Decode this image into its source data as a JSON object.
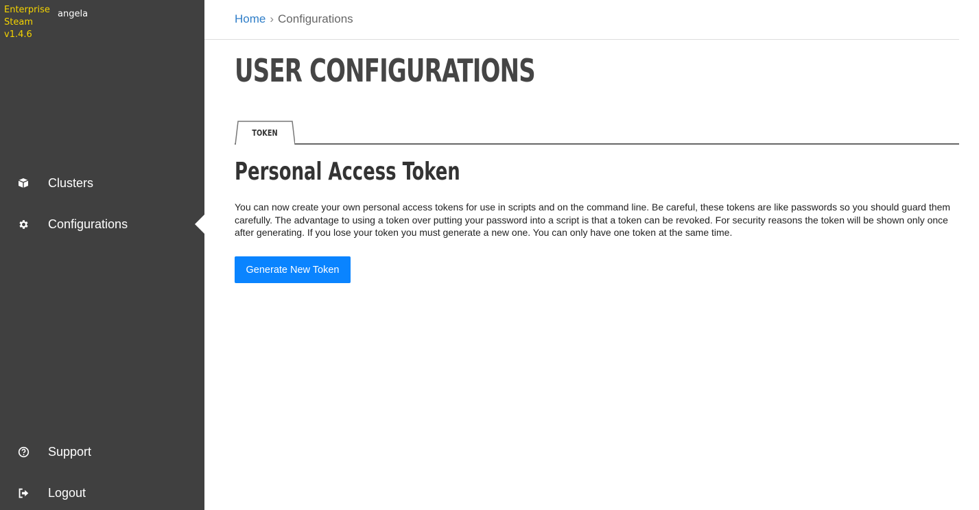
{
  "brand": {
    "line1": "Enterprise",
    "line2": "Steam",
    "version": "v1.4.6",
    "color": "#f5d400"
  },
  "user": {
    "name": "angela"
  },
  "sidebar": {
    "items": [
      {
        "label": "Clusters",
        "icon": "cube-icon"
      },
      {
        "label": "Configurations",
        "icon": "gear-icon",
        "active": true
      },
      {
        "label": "Support",
        "icon": "question-circle-icon"
      },
      {
        "label": "Logout",
        "icon": "sign-out-icon"
      }
    ],
    "background": "#404040"
  },
  "breadcrumb": {
    "home": "Home",
    "separator": "›",
    "current": "Configurations"
  },
  "page": {
    "title": "USER CONFIGURATIONS"
  },
  "tabs": [
    {
      "label": "TOKEN",
      "active": true
    }
  ],
  "token_section": {
    "title": "Personal Access Token",
    "description": "You can now create your own personal access tokens for use in scripts and on the command line. Be careful, these tokens are like passwords so you should guard them carefully. The advantage to using a token over putting your password into a script is that a token can be revoked. For security reasons the token will be shown only once after generating. If you lose your token you must generate a new one. You can only have one token at the same time.",
    "button_label": "Generate New Token",
    "button_color": "#0a84ff"
  }
}
